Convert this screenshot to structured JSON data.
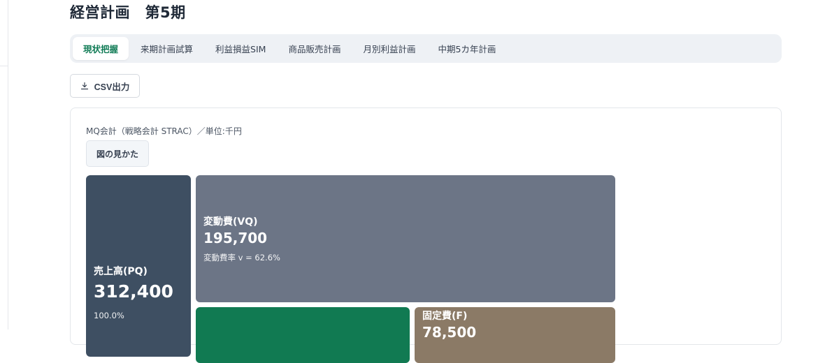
{
  "page": {
    "title": "経営計画　第5期"
  },
  "tabs": [
    {
      "label": "現状把握",
      "active": true
    },
    {
      "label": "来期計画試算",
      "active": false
    },
    {
      "label": "利益損益SIM",
      "active": false
    },
    {
      "label": "商品販売計画",
      "active": false
    },
    {
      "label": "月別利益計画",
      "active": false
    },
    {
      "label": "中期5カ年計画",
      "active": false
    }
  ],
  "toolbar": {
    "csv_label": "CSV出力",
    "csv_icon": "download-icon"
  },
  "mq_card": {
    "caption": "MQ会計（戦略会計 STRAC）／単位:千円",
    "howto_label": "図の見かた",
    "blocks": {
      "pq": {
        "label": "売上高(PQ)",
        "value": "312,400",
        "sub": "100.0%",
        "color": "#3e4f62"
      },
      "vq": {
        "label": "変動費(VQ)",
        "value": "195,700",
        "sub": "変動費率 v = 62.6%",
        "color": "#6c7586"
      },
      "mq": {
        "color": "#117a52"
      },
      "f": {
        "label": "固定費(F)",
        "value": "78,500",
        "color": "#8b7a66"
      }
    }
  },
  "colors": {
    "accent": "#0f7b55",
    "tab_bar_bg": "#eef1f5"
  }
}
